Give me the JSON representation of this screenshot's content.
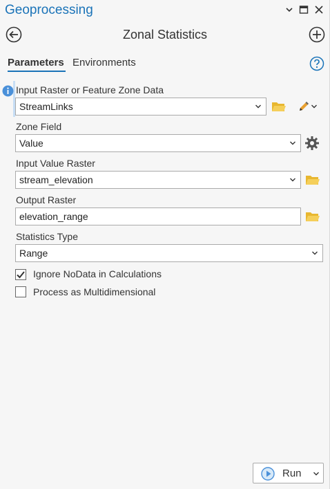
{
  "pane": {
    "title": "Geoprocessing"
  },
  "tool": {
    "title": "Zonal Statistics"
  },
  "tabs": [
    {
      "label": "Parameters",
      "active": true
    },
    {
      "label": "Environments",
      "active": false
    }
  ],
  "params": {
    "input_raster": {
      "label": "Input Raster or Feature Zone Data",
      "value": "StreamLinks"
    },
    "zone_field": {
      "label": "Zone Field",
      "value": "Value"
    },
    "value_raster": {
      "label": "Input Value Raster",
      "value": "stream_elevation"
    },
    "output_raster": {
      "label": "Output Raster",
      "value": "elevation_range"
    },
    "stat_type": {
      "label": "Statistics Type",
      "value": "Range"
    },
    "ignore_nodata": {
      "label": "Ignore NoData in Calculations",
      "checked": true
    },
    "multidim": {
      "label": "Process as Multidimensional",
      "checked": false
    }
  },
  "run": {
    "label": "Run"
  },
  "colors": {
    "accent": "#1a73b8",
    "folder": "#e8b730",
    "pencil": "#e8a030"
  },
  "icons": [
    "chevron-down-icon",
    "restore-icon",
    "close-icon",
    "back-arrow-icon",
    "add-icon",
    "help-icon",
    "info-icon",
    "folder-icon",
    "pencil-icon",
    "gear-icon",
    "play-icon"
  ]
}
